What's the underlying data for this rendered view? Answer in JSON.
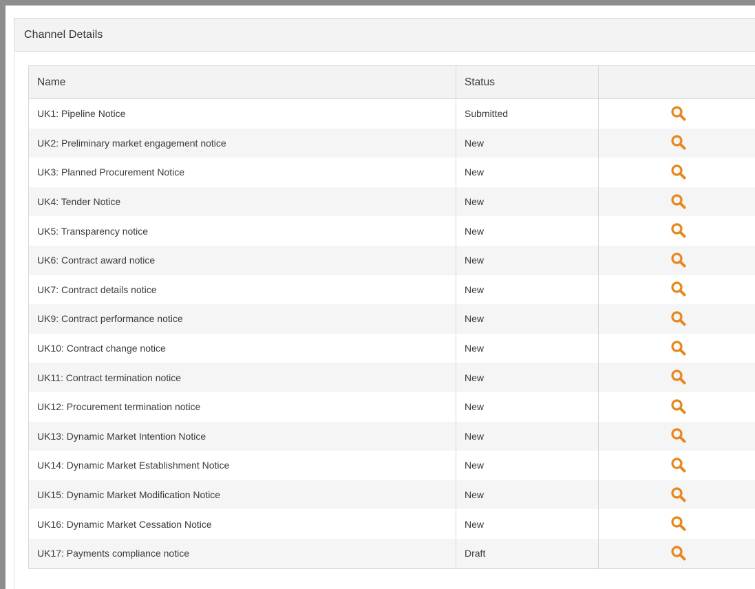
{
  "panel": {
    "title": "Channel Details"
  },
  "table": {
    "columns": [
      "Name",
      "Status",
      ""
    ],
    "rows": [
      {
        "name": "UK1: Pipeline Notice",
        "status": "Submitted"
      },
      {
        "name": "UK2: Preliminary market engagement notice",
        "status": "New"
      },
      {
        "name": "UK3: Planned Procurement Notice",
        "status": "New"
      },
      {
        "name": "UK4: Tender Notice",
        "status": "New"
      },
      {
        "name": "UK5: Transparency notice",
        "status": "New"
      },
      {
        "name": "UK6: Contract award notice",
        "status": "New"
      },
      {
        "name": "UK7: Contract details notice",
        "status": "New"
      },
      {
        "name": "UK9: Contract performance notice",
        "status": "New"
      },
      {
        "name": "UK10: Contract change notice",
        "status": "New"
      },
      {
        "name": "UK11: Contract termination notice",
        "status": "New"
      },
      {
        "name": "UK12: Procurement termination notice",
        "status": "New"
      },
      {
        "name": "UK13: Dynamic Market Intention Notice",
        "status": "New"
      },
      {
        "name": "UK14: Dynamic Market Establishment Notice",
        "status": "New"
      },
      {
        "name": "UK15: Dynamic Market Modification Notice",
        "status": "New"
      },
      {
        "name": "UK16: Dynamic Market Cessation Notice",
        "status": "New"
      },
      {
        "name": "UK17: Payments compliance notice",
        "status": "Draft"
      }
    ],
    "action_icon": "search-icon",
    "icon_color": "#e8861c"
  }
}
